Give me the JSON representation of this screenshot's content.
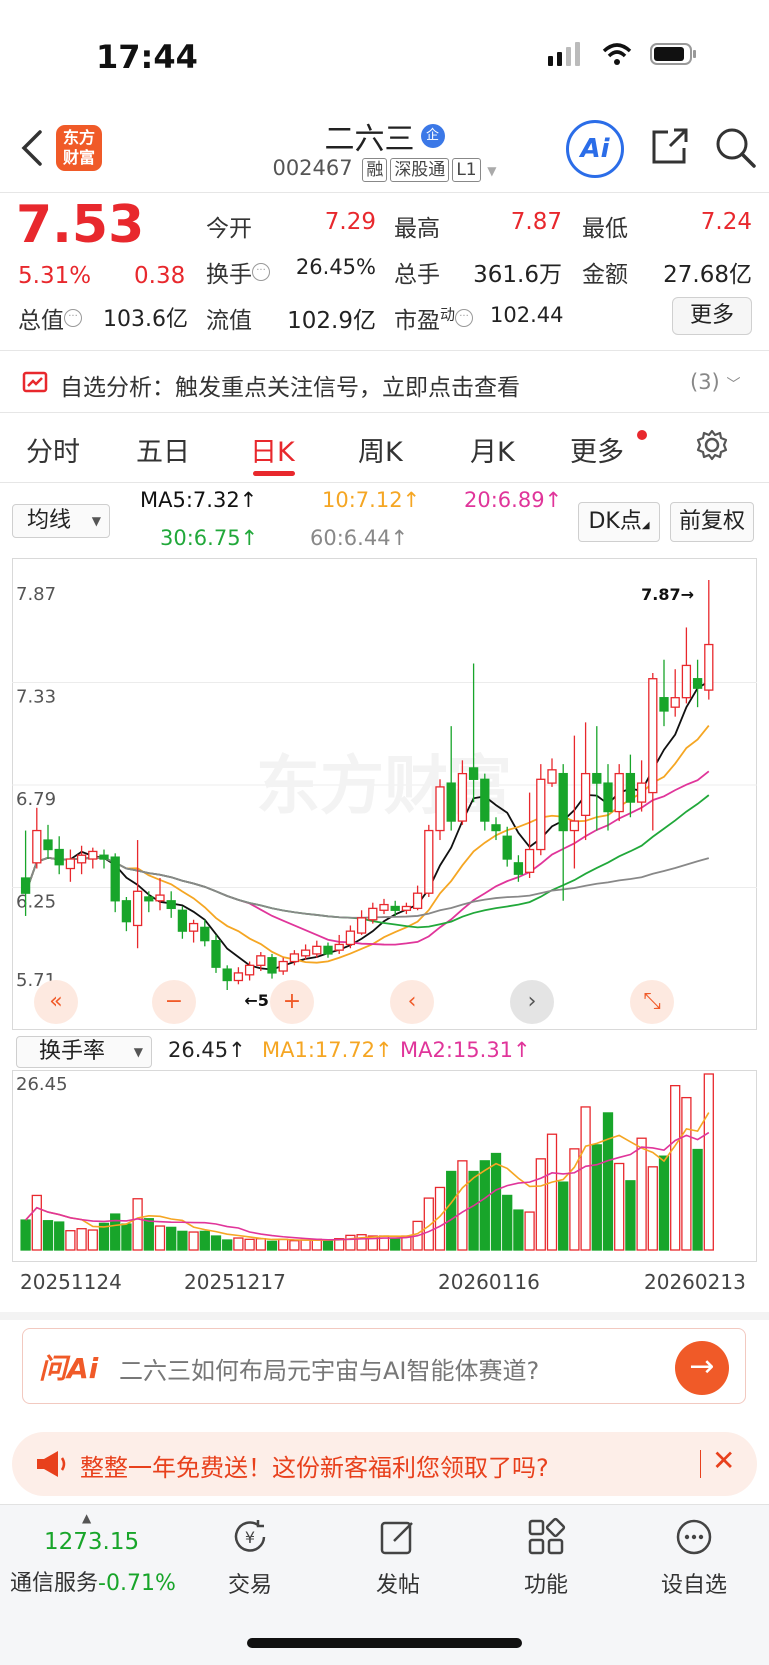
{
  "status_bar": {
    "time": "17:44"
  },
  "header": {
    "logo_text": "东方财富",
    "stock_name": "二六三",
    "enterprise_badge": "企",
    "stock_code": "002467",
    "tags": [
      "融",
      "深股通",
      "L1"
    ],
    "ai_label": "Ai"
  },
  "quote": {
    "price": "7.53",
    "change_pct": "5.31%",
    "change": "0.38",
    "open_label": "今开",
    "open": "7.29",
    "high_label": "最高",
    "high": "7.87",
    "low_label": "最低",
    "low": "7.24",
    "turnover_label": "换手",
    "turnover": "26.45%",
    "volume_label": "总手",
    "volume": "361.6万",
    "amount_label": "金额",
    "amount": "27.68亿",
    "mktcap_label": "总值",
    "mktcap": "103.6亿",
    "float_label": "流值",
    "float_cap": "102.9亿",
    "pe_label": "市盈",
    "pe_super": "动",
    "pe": "102.44",
    "more_label": "更多"
  },
  "alert": {
    "text": "自选分析：触发重点关注信号，立即点击查看",
    "count": "(3)"
  },
  "period_tabs": [
    "分时",
    "五日",
    "日K",
    "周K",
    "月K",
    "更多"
  ],
  "active_period": "日K",
  "indicators": {
    "ma_selector": "均线",
    "ma5": "MA5:7.32↑",
    "ma10": "10:7.12↑",
    "ma20": "20:6.89↑",
    "ma30": "30:6.75↑",
    "ma60": "60:6.44↑",
    "dk_button": "DK点",
    "adjust_button": "前复权"
  },
  "colors": {
    "up": "#e8282d",
    "down": "#18a52a",
    "ma5": "#111111",
    "ma10": "#f5a623",
    "ma20": "#e0359a",
    "ma30": "#21a83a",
    "ma60": "#888888"
  },
  "chart_data": {
    "type": "candlestick",
    "y_ticks": [
      "7.87",
      "7.33",
      "6.79",
      "6.25",
      "5.71"
    ],
    "ylim": [
      5.71,
      7.87
    ],
    "high_marker": "7.87→",
    "low_marker": "←5.71",
    "candles": [
      [
        6.3,
        6.22,
        6.55,
        6.1
      ],
      [
        6.38,
        6.55,
        6.67,
        6.35
      ],
      [
        6.5,
        6.45,
        6.58,
        6.4
      ],
      [
        6.45,
        6.37,
        6.52,
        6.32
      ],
      [
        6.35,
        6.4,
        6.45,
        6.28
      ],
      [
        6.38,
        6.42,
        6.47,
        6.32
      ],
      [
        6.4,
        6.44,
        6.46,
        6.35
      ],
      [
        6.42,
        6.4,
        6.45,
        6.35
      ],
      [
        6.41,
        6.18,
        6.43,
        6.12
      ],
      [
        6.18,
        6.07,
        6.2,
        6.02
      ],
      [
        6.05,
        6.23,
        6.5,
        5.93
      ],
      [
        6.2,
        6.18,
        6.23,
        6.12
      ],
      [
        6.18,
        6.21,
        6.3,
        6.13
      ],
      [
        6.18,
        6.14,
        6.23,
        6.09
      ],
      [
        6.13,
        6.02,
        6.15,
        5.98
      ],
      [
        6.02,
        6.06,
        6.08,
        5.96
      ],
      [
        6.04,
        5.97,
        6.08,
        5.94
      ],
      [
        5.97,
        5.83,
        6.0,
        5.8
      ],
      [
        5.82,
        5.76,
        5.84,
        5.71
      ],
      [
        5.76,
        5.8,
        5.83,
        5.74
      ],
      [
        5.79,
        5.84,
        5.86,
        5.76
      ],
      [
        5.84,
        5.89,
        5.91,
        5.81
      ],
      [
        5.88,
        5.8,
        5.9,
        5.77
      ],
      [
        5.81,
        5.86,
        5.88,
        5.79
      ],
      [
        5.86,
        5.9,
        5.92,
        5.84
      ],
      [
        5.89,
        5.92,
        5.95,
        5.87
      ],
      [
        5.9,
        5.94,
        5.97,
        5.88
      ],
      [
        5.94,
        5.9,
        5.96,
        5.88
      ],
      [
        5.92,
        5.95,
        6.0,
        5.9
      ],
      [
        5.95,
        6.02,
        6.05,
        5.93
      ],
      [
        6.01,
        6.09,
        6.13,
        6.0
      ],
      [
        6.08,
        6.14,
        6.17,
        6.06
      ],
      [
        6.13,
        6.16,
        6.19,
        6.11
      ],
      [
        6.15,
        6.13,
        6.18,
        6.1
      ],
      [
        6.13,
        6.15,
        6.17,
        6.11
      ],
      [
        6.14,
        6.22,
        6.26,
        6.13
      ],
      [
        6.22,
        6.55,
        6.58,
        6.2
      ],
      [
        6.55,
        6.78,
        6.82,
        6.5
      ],
      [
        6.8,
        6.6,
        7.1,
        6.55
      ],
      [
        6.6,
        6.85,
        6.92,
        6.58
      ],
      [
        6.88,
        6.82,
        7.43,
        6.7
      ],
      [
        6.82,
        6.6,
        6.85,
        6.55
      ],
      [
        6.58,
        6.55,
        6.62,
        6.5
      ],
      [
        6.52,
        6.4,
        6.57,
        6.36
      ],
      [
        6.38,
        6.32,
        6.42,
        6.28
      ],
      [
        6.33,
        6.45,
        6.75,
        6.3
      ],
      [
        6.45,
        6.82,
        6.9,
        6.42
      ],
      [
        6.8,
        6.87,
        6.93,
        6.78
      ],
      [
        6.85,
        6.55,
        6.9,
        6.18
      ],
      [
        6.55,
        6.6,
        7.05,
        6.35
      ],
      [
        6.63,
        6.85,
        7.12,
        6.5
      ],
      [
        6.85,
        6.8,
        7.1,
        6.55
      ],
      [
        6.8,
        6.65,
        6.9,
        6.55
      ],
      [
        6.65,
        6.85,
        6.9,
        6.6
      ],
      [
        6.85,
        6.7,
        6.95,
        6.62
      ],
      [
        6.7,
        6.8,
        6.92,
        6.65
      ],
      [
        6.75,
        7.35,
        7.38,
        6.55
      ],
      [
        7.25,
        7.18,
        7.45,
        7.1
      ],
      [
        7.2,
        7.25,
        7.4,
        7.15
      ],
      [
        7.25,
        7.42,
        7.62,
        7.22
      ],
      [
        7.35,
        7.3,
        7.45,
        7.2
      ],
      [
        7.29,
        7.53,
        7.87,
        7.24
      ]
    ],
    "candle_field_order": [
      "open",
      "close",
      "high",
      "low"
    ]
  },
  "chart_controls": [
    "«",
    "−",
    "+",
    "‹",
    "›",
    "⤡"
  ],
  "volume": {
    "selector": "换手率",
    "value": "26.45↑",
    "ma1": "MA1:17.72↑",
    "ma2": "MA2:15.31↑",
    "y_top": "26.45",
    "bars": [
      4.5,
      8.2,
      4.4,
      4.2,
      2.9,
      3.2,
      3.0,
      4.0,
      5.4,
      3.9,
      7.7,
      4.7,
      3.6,
      3.4,
      2.8,
      2.7,
      2.8,
      2.1,
      1.5,
      1.8,
      1.6,
      1.7,
      1.3,
      1.6,
      1.4,
      1.5,
      1.6,
      1.4,
      1.7,
      2.2,
      2.3,
      2.1,
      2.1,
      1.7,
      2.1,
      4.3,
      7.8,
      9.4,
      11.8,
      13.4,
      11.8,
      13.4,
      14.5,
      8.2,
      6.0,
      5.7,
      13.7,
      17.4,
      10.2,
      15.2,
      21.5,
      15.8,
      20.6,
      13.0,
      10.4,
      16.8,
      12.5,
      14.1,
      24.7,
      22.9,
      15.1,
      26.45
    ],
    "dates": [
      "20251124",
      "20251217",
      "20260116",
      "20260213"
    ]
  },
  "ask": {
    "logo": "问Ai",
    "placeholder": "二六三如何布局元宇宙与AI智能体赛道?"
  },
  "promo": {
    "text": "整整一年免费送！这份新客福利您领取了吗?",
    "close": "✕"
  },
  "bottom_nav": {
    "index_value": "1273.15",
    "index_label": "通信服务",
    "index_change": "-0.71%",
    "items": [
      "交易",
      "发帖",
      "功能",
      "设自选"
    ]
  }
}
